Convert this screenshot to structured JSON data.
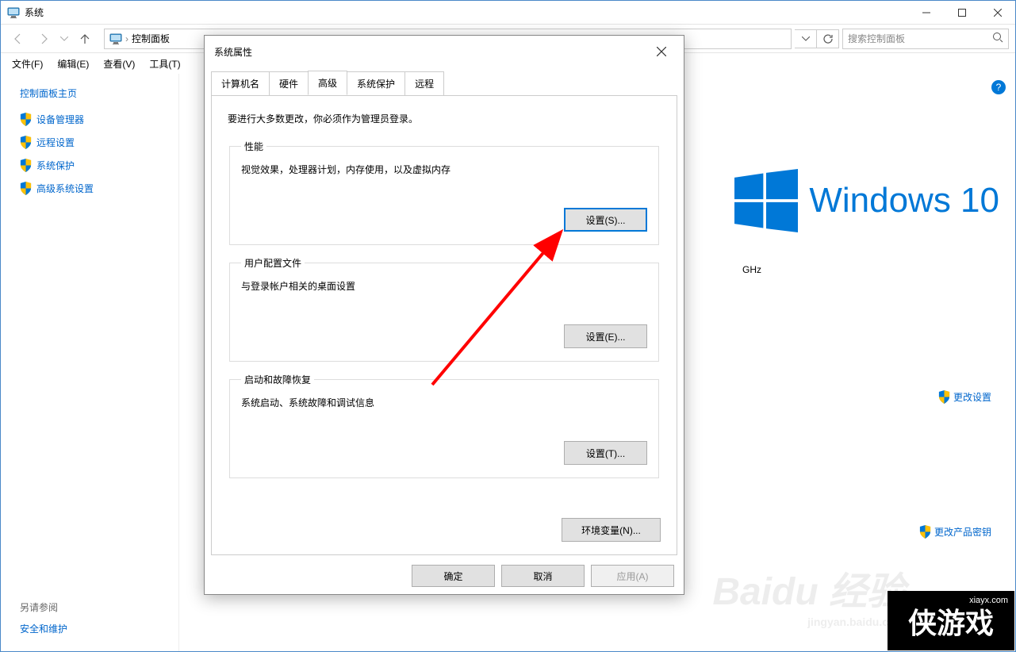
{
  "window": {
    "title": "系统",
    "breadcrumb": "控制面板",
    "search_placeholder": "搜索控制面板"
  },
  "menubar": {
    "file": "文件(F)",
    "edit": "编辑(E)",
    "view": "查看(V)",
    "tools": "工具(T)"
  },
  "sidebar": {
    "head": "控制面板主页",
    "items": [
      {
        "label": "设备管理器"
      },
      {
        "label": "远程设置"
      },
      {
        "label": "系统保护"
      },
      {
        "label": "高级系统设置"
      }
    ],
    "footer_label": "另请参阅",
    "footer_link": "安全和维护"
  },
  "main": {
    "os_name": "Windows 10",
    "ghz": "GHz",
    "change_settings": "更改设置",
    "change_key": "更改产品密钥"
  },
  "dialog": {
    "title": "系统属性",
    "tabs": {
      "computer_name": "计算机名",
      "hardware": "硬件",
      "advanced": "高级",
      "system_protection": "系统保护",
      "remote": "远程"
    },
    "intro": "要进行大多数更改，你必须作为管理员登录。",
    "performance": {
      "legend": "性能",
      "desc": "视觉效果，处理器计划，内存使用，以及虚拟内存",
      "button": "设置(S)..."
    },
    "user_profiles": {
      "legend": "用户配置文件",
      "desc": "与登录帐户相关的桌面设置",
      "button": "设置(E)..."
    },
    "startup": {
      "legend": "启动和故障恢复",
      "desc": "系统启动、系统故障和调试信息",
      "button": "设置(T)..."
    },
    "env_button": "环境变量(N)...",
    "ok": "确定",
    "cancel": "取消",
    "apply": "应用(A)"
  },
  "watermark": {
    "baidu": "Baidu 经验",
    "baidu_sub": "jingyan.baidu.com",
    "xia": "侠游戏",
    "xia_url": "xiayx.com"
  }
}
